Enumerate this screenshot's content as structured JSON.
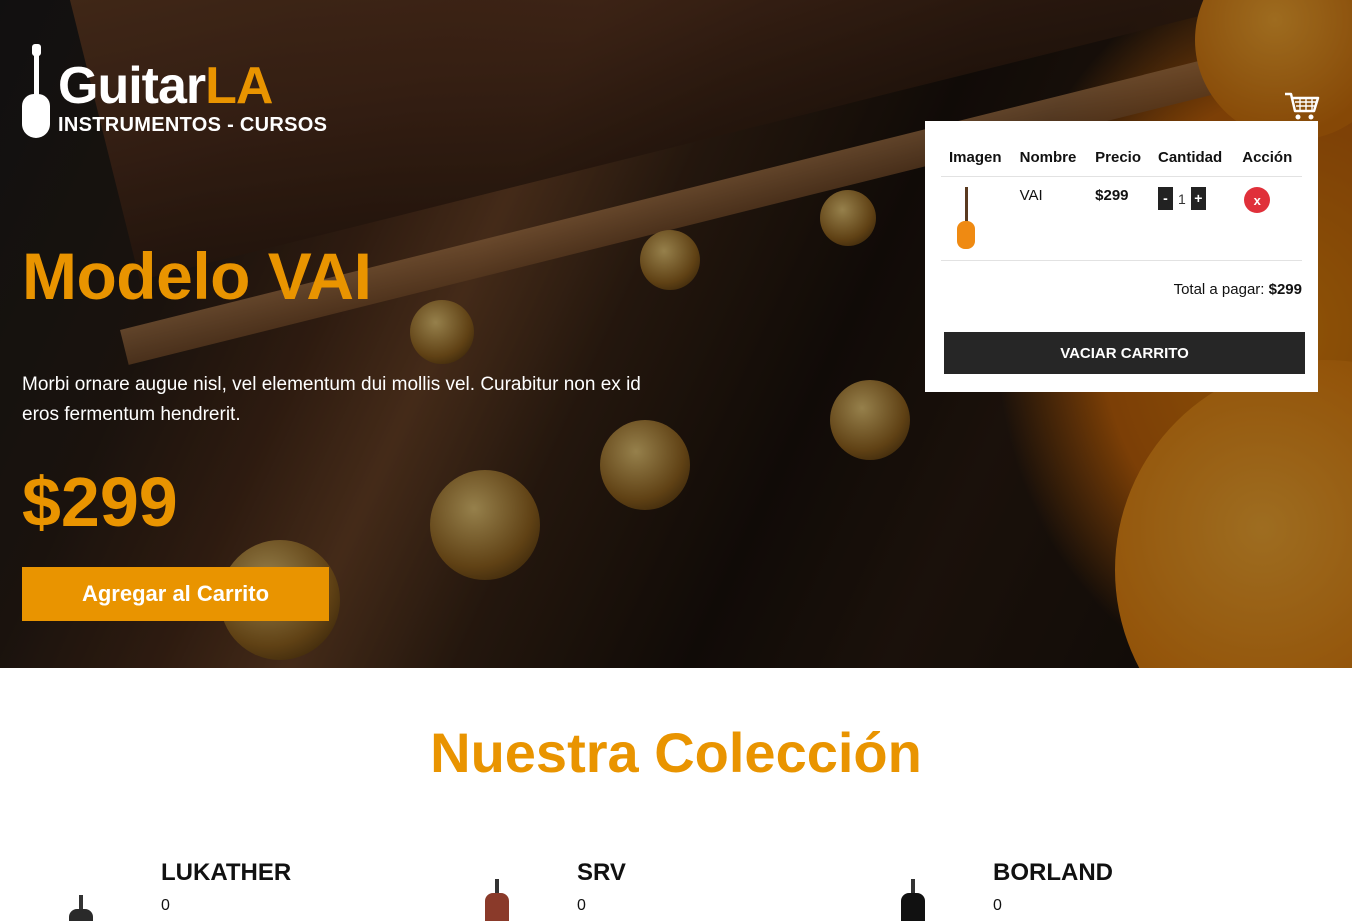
{
  "header": {
    "brand_main": "Guitar",
    "brand_accent": "LA",
    "tagline": "INSTRUMENTOS - CURSOS"
  },
  "hero": {
    "title": "Modelo VAI",
    "description": "Morbi ornare augue nisl, vel elementum dui mollis vel. Curabitur non ex id eros fermentum hendrerit.",
    "price": "$299",
    "button_label": "Agregar al Carrito"
  },
  "cart": {
    "icon": "cart-icon",
    "headers": [
      "Imagen",
      "Nombre",
      "Precio",
      "Cantidad",
      "Acción"
    ],
    "items": [
      {
        "name": "VAI",
        "price": "$299",
        "quantity": "1",
        "decrement_label": "-",
        "increment_label": "+",
        "remove_label": "x"
      }
    ],
    "total_label": "Total a pagar: ",
    "total_value": "$299",
    "empty_button_label": "VACIAR CARRITO"
  },
  "collection": {
    "title": "Nuestra Colección",
    "products": [
      {
        "name": "LUKATHER",
        "value": "0"
      },
      {
        "name": "SRV",
        "value": "0"
      },
      {
        "name": "BORLAND",
        "value": "0"
      }
    ]
  },
  "colors": {
    "accent": "#e99400",
    "dark": "#262626",
    "danger": "#e0303a"
  }
}
